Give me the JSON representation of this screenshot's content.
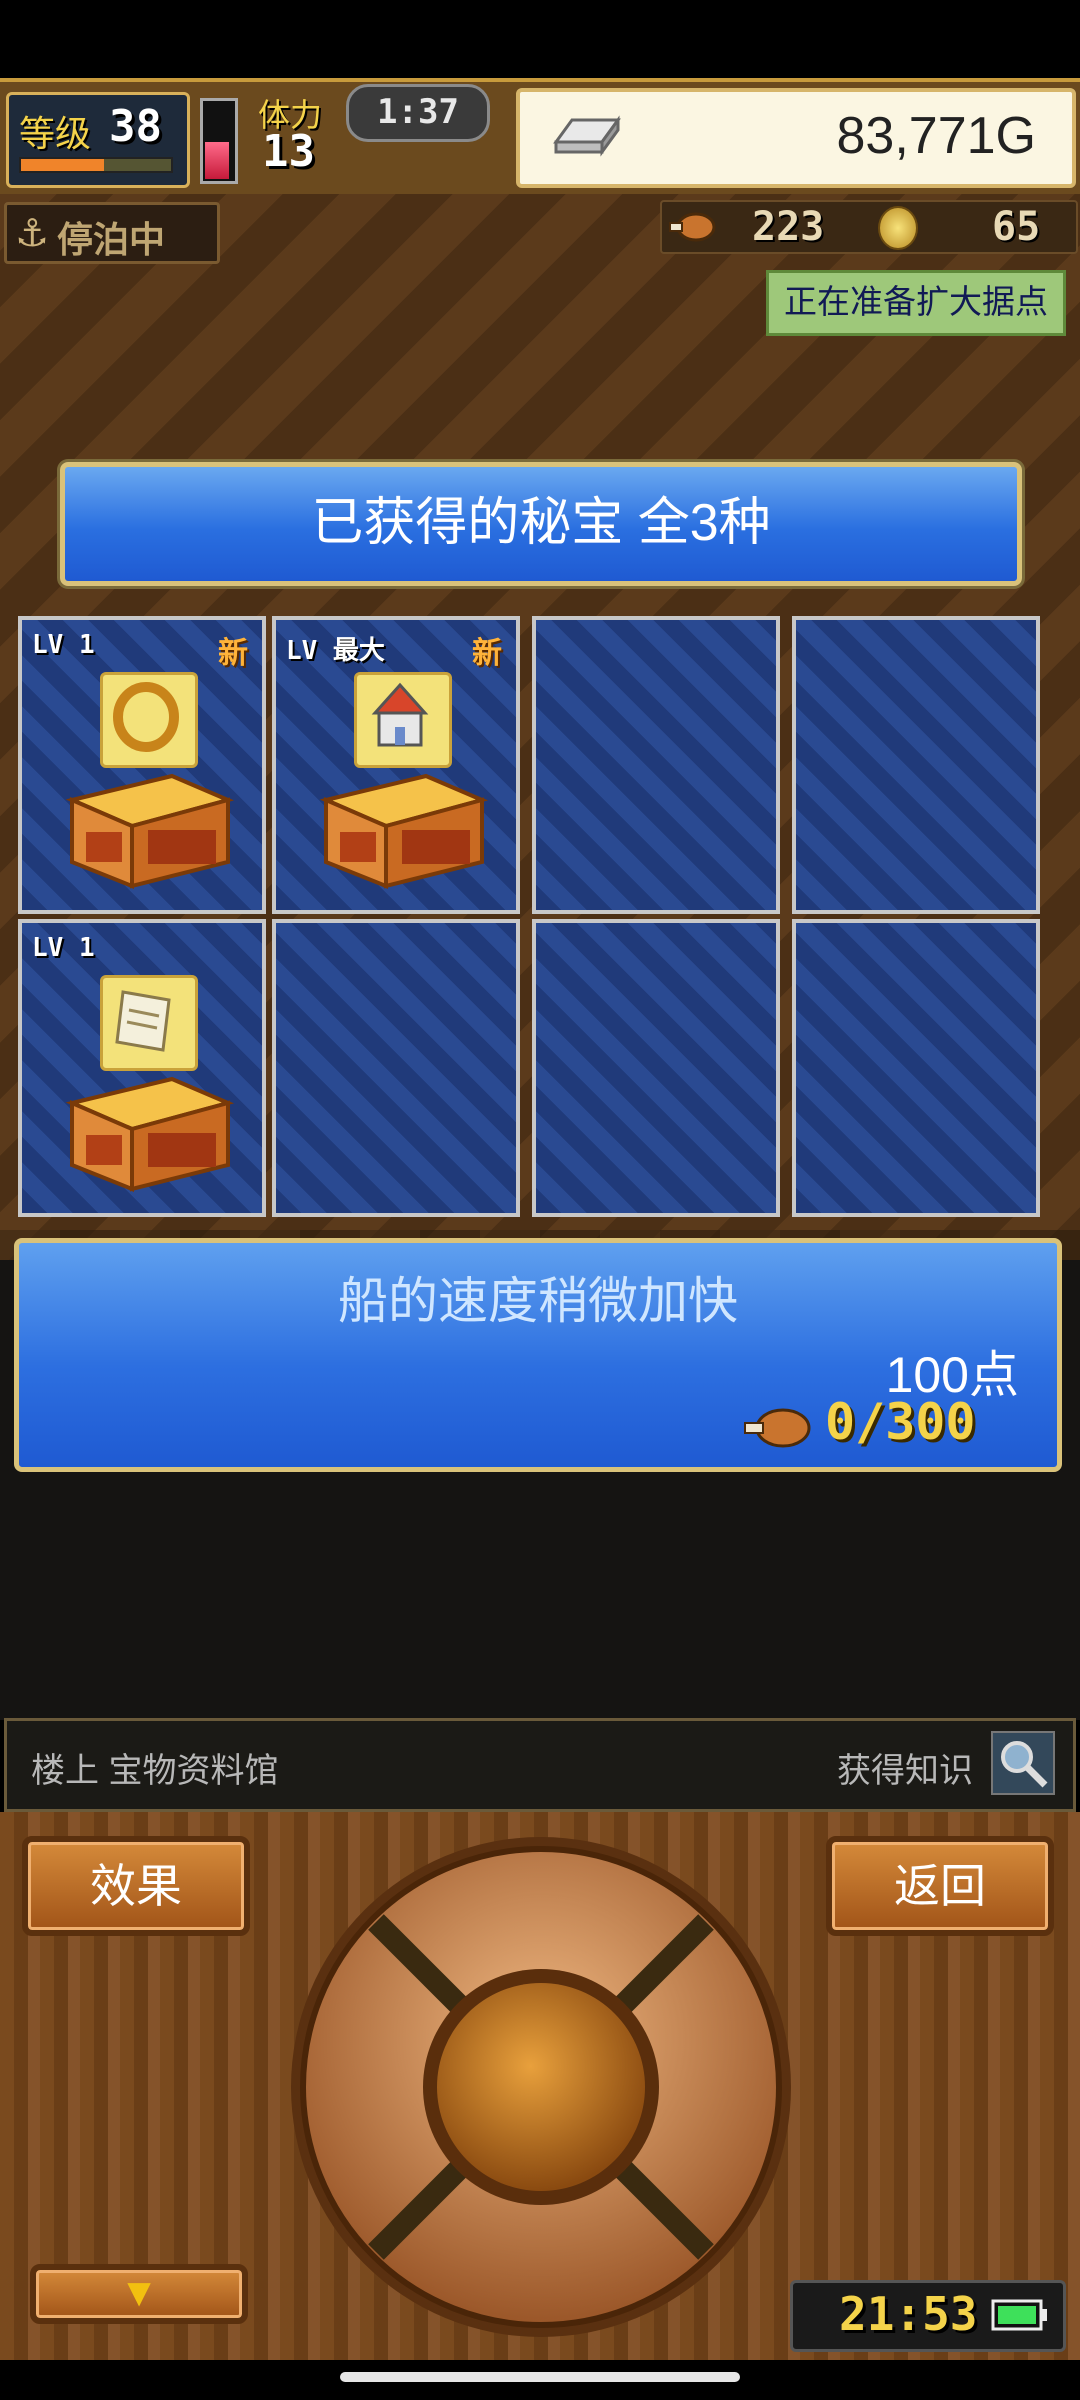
{
  "hud": {
    "level_label": "等级",
    "level": "38",
    "level_progress": 0.55,
    "stamina_label": "体力",
    "stamina": "13",
    "stamina_fill": 0.5,
    "timer": "1:37",
    "gold": "83,771G"
  },
  "scene": {
    "status_badge": "停泊中",
    "food_count": "223",
    "medal_count": "65",
    "notice": "正在准备扩大据点"
  },
  "treasure": {
    "title": "已获得的秘宝 全3种",
    "cells": [
      {
        "lv": "LV 1",
        "badge": "新",
        "item": "ring-icon"
      },
      {
        "lv": "LV 最大",
        "badge": "新",
        "item": "castle-icon"
      },
      {
        "lv": "",
        "badge": "",
        "item": ""
      },
      {
        "lv": "",
        "badge": "",
        "item": ""
      },
      {
        "lv": "LV 1",
        "badge": "",
        "item": "scroll-icon"
      },
      {
        "lv": "",
        "badge": "",
        "item": ""
      },
      {
        "lv": "",
        "badge": "",
        "item": ""
      },
      {
        "lv": "",
        "badge": "",
        "item": ""
      }
    ],
    "description": "船的速度稍微加快",
    "points": "100点",
    "progress": "0/300"
  },
  "bottom": {
    "location": "楼上 宝物资料馆",
    "knowledge": "获得知识",
    "effect_label": "效果",
    "back_label": "返回",
    "down_label": "▼",
    "clock": "21:53"
  },
  "colors": {
    "panel_blue": "#2a6fe0",
    "gold_text": "#f4d34a",
    "new_badge": "#ffb33a"
  }
}
